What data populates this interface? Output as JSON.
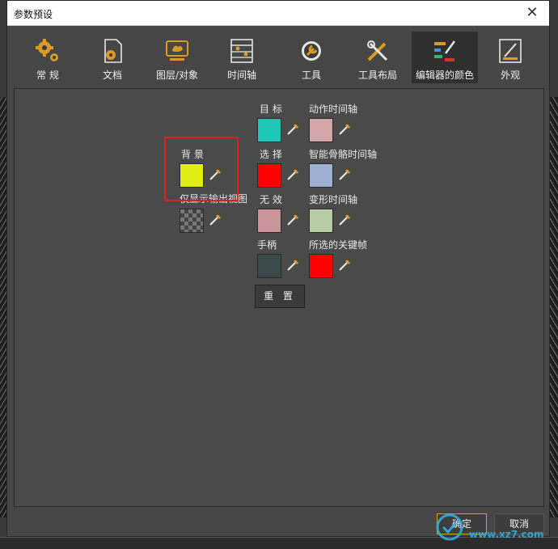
{
  "window": {
    "title": "参数预设",
    "close_label": "✕"
  },
  "tabs": [
    {
      "label": "常 规",
      "icon": "gears-icon"
    },
    {
      "label": "文档",
      "icon": "document-gear-icon"
    },
    {
      "label": "图层/对象",
      "icon": "layer-object-icon"
    },
    {
      "label": "时间轴",
      "icon": "timeline-icon"
    },
    {
      "label": "工具",
      "icon": "wrench-icon"
    },
    {
      "label": "工具布局",
      "icon": "tools-layout-icon"
    },
    {
      "label": "编辑器的颜色",
      "icon": "editor-colors-icon",
      "active": true
    },
    {
      "label": "外观",
      "icon": "appearance-icon"
    }
  ],
  "colors": {
    "background": {
      "label": "背 景",
      "color": "#e1ee14"
    },
    "output_only": {
      "label": "仅显示输出视图"
    },
    "target": {
      "label": "目 标",
      "color": "#1ec8b8"
    },
    "selection": {
      "label": "选 择",
      "color": "#ff0000"
    },
    "invalid": {
      "label": "无 效",
      "color": "#c9959a"
    },
    "handle": {
      "label": "手柄",
      "color": "#3a4a4a"
    },
    "action_timeline": {
      "label": "动作时间轴",
      "color": "#d4a6aa"
    },
    "smart_bone_timeline": {
      "label": "智能骨骼时间轴",
      "color": "#9eb1d3"
    },
    "deform_timeline": {
      "label": "变形时间轴",
      "color": "#b8cca6"
    },
    "selected_keyframe": {
      "label": "所选的关键帧",
      "color": "#ff0000"
    }
  },
  "buttons": {
    "reset": "重 置",
    "ok": "确定",
    "cancel": "取消"
  },
  "accent": "#d8a21a",
  "watermark": "www.xz7.com"
}
